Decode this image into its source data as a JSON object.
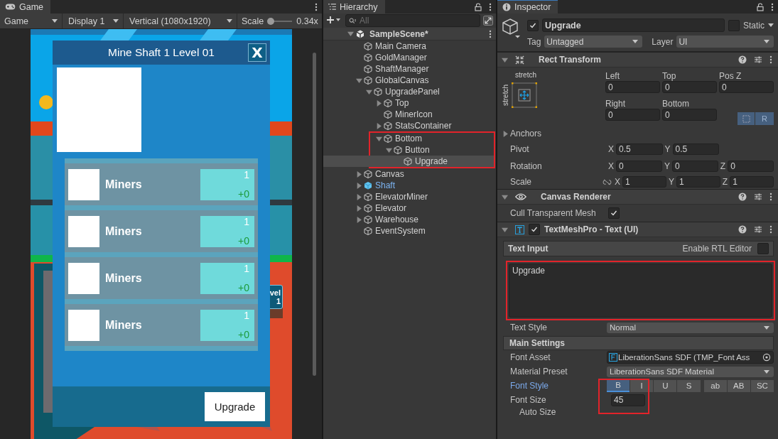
{
  "game": {
    "tab": "Game",
    "view": "Game",
    "display": "Display 1",
    "resolution": "Vertical (1080x1920)",
    "scale": {
      "label": "Scale",
      "level": 0.1,
      "reading": "0.34x"
    },
    "badge": {
      "lines": [
        "vel",
        "1"
      ]
    },
    "panel": {
      "title": "Mine Shaft 1 Level 01",
      "close": "X",
      "button": "Upgrade",
      "stats": [
        {
          "label": "Miners",
          "value": "1",
          "bonus": "+0"
        },
        {
          "label": "Miners",
          "value": "1",
          "bonus": "+0"
        },
        {
          "label": "Miners",
          "value": "1",
          "bonus": "+0"
        },
        {
          "label": "Miners",
          "value": "1",
          "bonus": "+0"
        }
      ]
    }
  },
  "hierarchy": {
    "tab": "Hierarchy",
    "search": {
      "placeholder": "All"
    },
    "scene": {
      "name": "SampleScene*",
      "expanded": true
    },
    "items": [
      {
        "name": "Main Camera",
        "kind": "object",
        "selected": false
      },
      {
        "name": "GoldManager",
        "kind": "object",
        "selected": false
      },
      {
        "name": "ShaftManager",
        "kind": "object",
        "selected": false
      },
      {
        "name": "GlobalCanvas",
        "kind": "object",
        "selected": false,
        "expanded": true,
        "children": [
          {
            "name": "UpgradePanel",
            "kind": "object",
            "selected": false,
            "expanded": true,
            "children": [
              {
                "name": "Top",
                "kind": "object",
                "selected": false,
                "expanded": false
              },
              {
                "name": "MinerIcon",
                "kind": "object",
                "selected": false
              },
              {
                "name": "StatsContainer",
                "kind": "object",
                "selected": false,
                "expanded": false
              },
              {
                "name": "Bottom",
                "kind": "object",
                "selected": false,
                "expanded": true,
                "annotated": true,
                "children": [
                  {
                    "name": "Button",
                    "kind": "object",
                    "selected": false,
                    "expanded": true,
                    "children": [
                      {
                        "name": "Upgrade",
                        "kind": "object",
                        "selected": true
                      }
                    ]
                  }
                ]
              }
            ]
          }
        ]
      },
      {
        "name": "Canvas",
        "kind": "object",
        "selected": false,
        "expanded": false
      },
      {
        "name": "Shaft",
        "kind": "prefab",
        "selected": false,
        "expanded": false
      },
      {
        "name": "ElevatorMiner",
        "kind": "object",
        "selected": false,
        "expanded": false
      },
      {
        "name": "Elevator",
        "kind": "object",
        "selected": false,
        "expanded": false
      },
      {
        "name": "Warehouse",
        "kind": "object",
        "selected": false,
        "expanded": false
      },
      {
        "name": "EventSystem",
        "kind": "object",
        "selected": false
      }
    ]
  },
  "inspector": {
    "tab": "Inspector",
    "object": {
      "active": true,
      "name": "Upgrade",
      "static": {
        "label": "Static",
        "checked": false
      },
      "tag": {
        "label": "Tag",
        "value": "Untagged"
      },
      "layer": {
        "label": "Layer",
        "value": "UI"
      }
    },
    "rect_transform": {
      "title": "Rect Transform",
      "expanded": true,
      "anchor": {
        "horizontal": "stretch",
        "vertical": "stretch"
      },
      "fields": [
        {
          "label": "Left",
          "value": "0"
        },
        {
          "label": "Top",
          "value": "0"
        },
        {
          "label": "Pos Z",
          "value": "0"
        },
        {
          "label": "Right",
          "value": "0"
        },
        {
          "label": "Bottom",
          "value": "0"
        }
      ],
      "raw_button": "R",
      "anchors": {
        "label": "Anchors",
        "expanded": false
      },
      "pivot": {
        "label": "Pivot",
        "axes": [
          {
            "axis": "X",
            "value": "0.5"
          },
          {
            "axis": "Y",
            "value": "0.5"
          }
        ]
      },
      "rotation": {
        "label": "Rotation",
        "axes": [
          {
            "axis": "X",
            "value": "0"
          },
          {
            "axis": "Y",
            "value": "0"
          },
          {
            "axis": "Z",
            "value": "0"
          }
        ]
      },
      "scale": {
        "label": "Scale",
        "axes": [
          {
            "axis": "X",
            "value": "1"
          },
          {
            "axis": "Y",
            "value": "1"
          },
          {
            "axis": "Z",
            "value": "1"
          }
        ]
      }
    },
    "canvas_renderer": {
      "title": "Canvas Renderer",
      "expanded": true,
      "cull": {
        "label": "Cull Transparent Mesh",
        "checked": true
      }
    },
    "tmp": {
      "title": "TextMeshPro - Text (UI)",
      "expanded": true,
      "enabled": true,
      "text_input": {
        "label": "Text Input",
        "rtl": {
          "label": "Enable RTL Editor",
          "checked": false
        },
        "value": "Upgrade",
        "annotated": true
      },
      "text_style": {
        "label": "Text Style",
        "value": "Normal"
      },
      "main_settings": "Main Settings",
      "font_asset": {
        "label": "Font Asset",
        "value": "LiberationSans SDF (TMP_Font Ass"
      },
      "material_preset": {
        "label": "Material Preset",
        "value": "LiberationSans SDF Material"
      },
      "font_style": {
        "label": "Font Style",
        "annotated": true,
        "buttons": [
          {
            "label": "B",
            "selected": true
          },
          {
            "label": "I",
            "selected": false
          },
          {
            "label": "U",
            "selected": false
          },
          {
            "label": "S",
            "selected": false
          },
          {
            "label": "ab",
            "selected": false
          },
          {
            "label": "AB",
            "selected": false
          },
          {
            "label": "SC",
            "selected": false
          }
        ]
      },
      "font_size": {
        "label": "Font Size",
        "value": "45"
      },
      "auto_size": {
        "label": "Auto Size"
      }
    }
  }
}
